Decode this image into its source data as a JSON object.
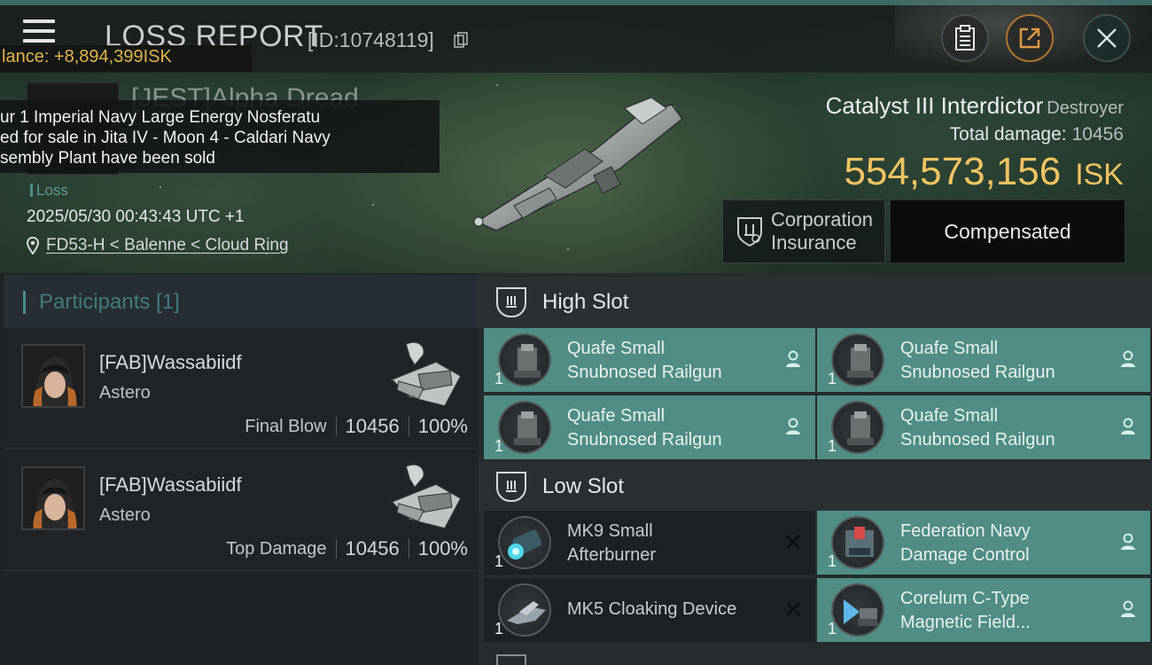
{
  "header": {
    "title": "LOSS REPORT",
    "report_id": "[ID:10748119]",
    "balance": "lance: +8,894,399ISK"
  },
  "victim": {
    "name": "[JEST]Alpha Dread",
    "loss_tag": "Loss",
    "datetime": "2025/05/30 00:43:43 UTC +1",
    "location": "FD53-H < Balenne < Cloud Ring"
  },
  "notification": {
    "lines": [
      "ur 1 Imperial Navy Large Energy Nosferatu",
      "ed for sale in Jita IV - Moon 4 - Caldari Navy",
      "sembly Plant have been sold"
    ]
  },
  "ship": {
    "name": "Catalyst III Interdictor",
    "class": "Destroyer",
    "total_damage_label": "Total damage:",
    "total_damage": "10456",
    "isk_value": "554,573,156",
    "isk_unit": "ISK"
  },
  "insurance": {
    "button_label_line1": "Corporation",
    "button_label_line2": "Insurance",
    "status": "Compensated"
  },
  "participants": {
    "header": "Participants [1]",
    "rows": [
      {
        "name": "[FAB]Wassabiidf",
        "ship": "Astero",
        "role": "Final Blow",
        "damage": "10456",
        "percent": "100%"
      },
      {
        "name": "[FAB]Wassabiidf",
        "ship": "Astero",
        "role": "Top Damage",
        "damage": "10456",
        "percent": "100%"
      }
    ]
  },
  "fittings": {
    "high_slot_label": "High Slot",
    "low_slot_label": "Low Slot",
    "high": [
      {
        "line1": "Quafe Small",
        "line2": "Snubnosed Railgun",
        "qty": "1",
        "state": "fitted"
      },
      {
        "line1": "Quafe Small",
        "line2": "Snubnosed Railgun",
        "qty": "1",
        "state": "fitted"
      },
      {
        "line1": "Quafe Small",
        "line2": "Snubnosed Railgun",
        "qty": "1",
        "state": "fitted"
      },
      {
        "line1": "Quafe Small",
        "line2": "Snubnosed Railgun",
        "qty": "1",
        "state": "fitted"
      }
    ],
    "low": [
      {
        "line1": "MK9 Small",
        "line2": "Afterburner",
        "qty": "1",
        "state": "destroyed"
      },
      {
        "line1": "Federation Navy",
        "line2": "Damage Control",
        "qty": "1",
        "state": "fitted"
      },
      {
        "line1": "MK5 Cloaking Device",
        "line2": "",
        "qty": "1",
        "state": "destroyed"
      },
      {
        "line1": "Corelum C-Type",
        "line2": "Magnetic Field...",
        "qty": "1",
        "state": "fitted"
      }
    ]
  },
  "colors": {
    "accent_teal": "#4f8d85",
    "isk_gold": "#f2c462",
    "balance_gold": "#e0b44f"
  }
}
